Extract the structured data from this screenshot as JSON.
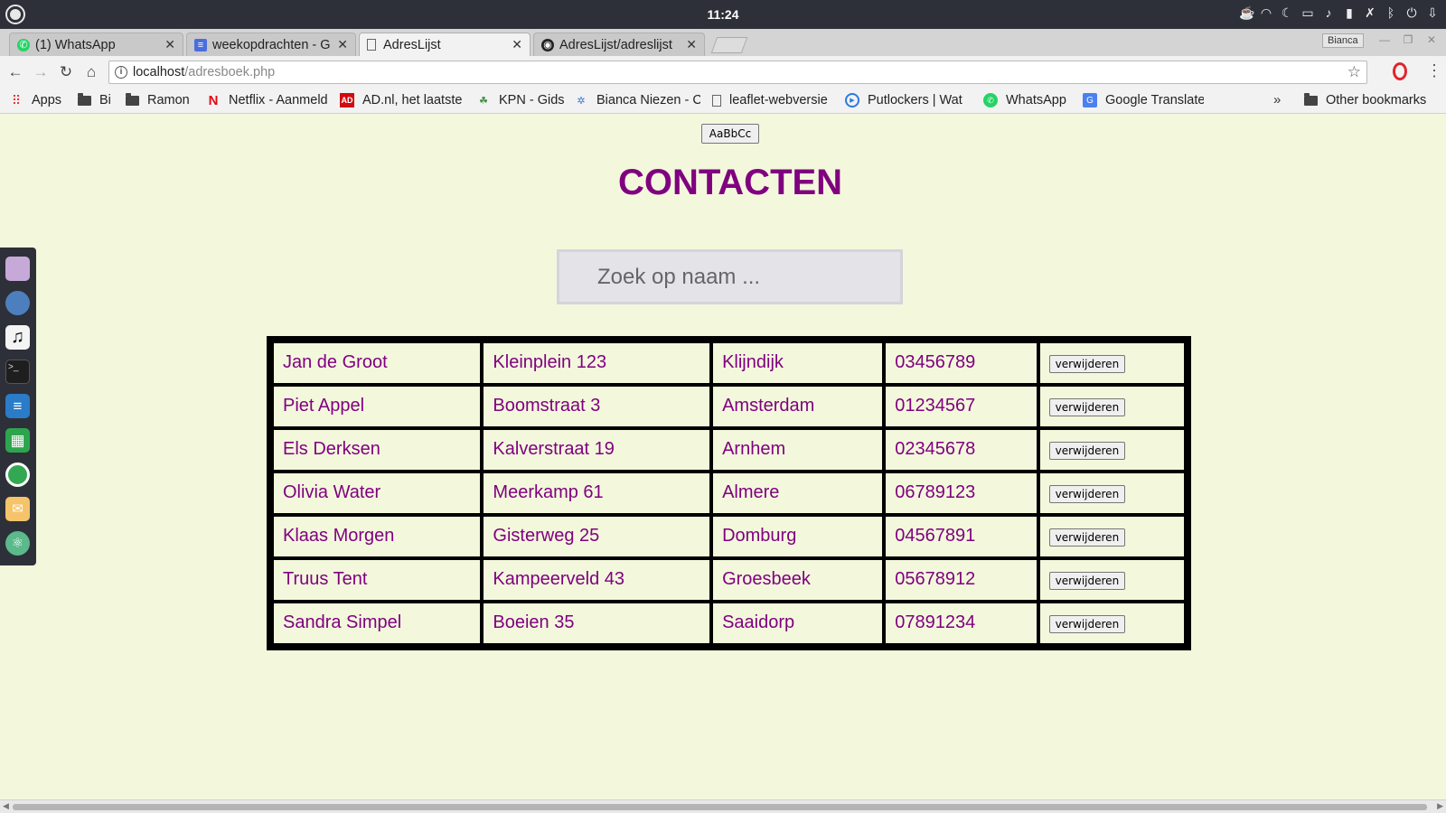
{
  "system": {
    "clock": "11:24",
    "tray_icons": [
      "cup-icon",
      "wifi-icon",
      "moon-icon",
      "folder-icon",
      "bell-icon",
      "battery-icon",
      "no-mic-icon",
      "bluetooth-icon",
      "power-icon",
      "arrow-down-icon"
    ]
  },
  "browser": {
    "tabs": [
      {
        "title": "(1) WhatsApp",
        "icon": "whatsapp-icon",
        "active": false
      },
      {
        "title": "weekopdrachten - G",
        "icon": "docs-icon",
        "active": false
      },
      {
        "title": "AdresLijst",
        "icon": "page-icon",
        "active": true
      },
      {
        "title": "AdresLijst/adreslijst",
        "icon": "github-icon",
        "active": false
      }
    ],
    "profile_name": "Bianca",
    "url_host": "localhost",
    "url_path": "/adresboek.php",
    "bookmarks": [
      {
        "label": "Apps",
        "icon": "apps-grid-icon"
      },
      {
        "label": "Bi",
        "icon": "folder-icon"
      },
      {
        "label": "Ramon",
        "icon": "folder-icon"
      },
      {
        "label": "Netflix - Aanmelden",
        "icon": "netflix-icon"
      },
      {
        "label": "AD.nl, het laatste",
        "icon": "ad-icon"
      },
      {
        "label": "KPN - Gids",
        "icon": "kpn-icon"
      },
      {
        "label": "Bianca Niezen - C",
        "icon": "sparkle-icon"
      },
      {
        "label": "leaflet-webversie",
        "icon": "page-icon"
      },
      {
        "label": "Putlockers | Wat",
        "icon": "play-icon"
      },
      {
        "label": "WhatsApp",
        "icon": "whatsapp-icon"
      },
      {
        "label": "Google Translate",
        "icon": "translate-icon"
      }
    ],
    "bookmarks_overflow": "»",
    "other_bookmarks": "Other bookmarks"
  },
  "page": {
    "font_button_label": "AaBbCc",
    "title": "CONTACTEN",
    "search_placeholder": "Zoek op naam ...",
    "delete_label": "verwijderen",
    "contacts": [
      {
        "name": "Jan de Groot",
        "address": "Kleinplein 123",
        "city": "Klijndijk",
        "phone": "03456789"
      },
      {
        "name": "Piet Appel",
        "address": "Boomstraat 3",
        "city": "Amsterdam",
        "phone": "01234567"
      },
      {
        "name": "Els Derksen",
        "address": "Kalverstraat 19",
        "city": "Arnhem",
        "phone": "02345678"
      },
      {
        "name": "Olivia Water",
        "address": "Meerkamp 61",
        "city": "Almere",
        "phone": "06789123"
      },
      {
        "name": "Klaas Morgen",
        "address": "Gisterweg 25",
        "city": "Domburg",
        "phone": "04567891"
      },
      {
        "name": "Truus Tent",
        "address": "Kampeerveld 43",
        "city": "Groesbeek",
        "phone": "05678912"
      },
      {
        "name": "Sandra Simpel",
        "address": "Boeien 35",
        "city": "Saaidorp",
        "phone": "07891234"
      }
    ]
  },
  "colors": {
    "accent": "#800080",
    "background": "#f3f8dc"
  }
}
